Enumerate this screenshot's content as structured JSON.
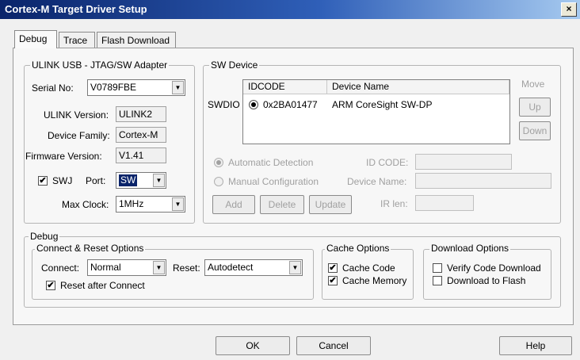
{
  "window": {
    "title": "Cortex-M Target Driver Setup",
    "close_glyph": "×"
  },
  "tabs": [
    "Debug",
    "Trace",
    "Flash Download"
  ],
  "ulink": {
    "title": "ULINK USB - JTAG/SW Adapter",
    "serial_label": "Serial No:",
    "serial_value": "V0789FBE",
    "version_label": "ULINK Version:",
    "version_value": "ULINK2",
    "family_label": "Device Family:",
    "family_value": "Cortex-M",
    "firmware_label": "Firmware Version:",
    "firmware_value": "V1.41",
    "swj_label": "SWJ",
    "swj_checked": true,
    "port_label": "Port:",
    "port_value": "SW",
    "maxclock_label": "Max Clock:",
    "maxclock_value": "1MHz"
  },
  "sw_device": {
    "title": "SW Device",
    "swdio_label": "SWDIO",
    "col_idcode": "IDCODE",
    "col_name": "Device Name",
    "row_idcode": "0x2BA01477",
    "row_name": "ARM CoreSight SW-DP",
    "move_label": "Move",
    "up_label": "Up",
    "down_label": "Down",
    "auto_label": "Automatic Detection",
    "manual_label": "Manual Configuration",
    "idcode_label": "ID CODE:",
    "devname_label": "Device Name:",
    "add_label": "Add",
    "delete_label": "Delete",
    "update_label": "Update",
    "irlen_label": "IR len:"
  },
  "debug": {
    "title": "Debug",
    "connect_group": "Connect & Reset Options",
    "connect_label": "Connect:",
    "connect_value": "Normal",
    "reset_label": "Reset:",
    "reset_value": "Autodetect",
    "reset_after_label": "Reset after Connect",
    "reset_after_checked": true,
    "cache_group": "Cache Options",
    "cache_code_label": "Cache Code",
    "cache_code_checked": true,
    "cache_mem_label": "Cache Memory",
    "cache_mem_checked": true,
    "download_group": "Download Options",
    "verify_label": "Verify Code Download",
    "verify_checked": false,
    "flash_label": "Download to Flash",
    "flash_checked": false
  },
  "footer": {
    "ok": "OK",
    "cancel": "Cancel",
    "help": "Help"
  },
  "glyphs": {
    "check": "✔",
    "arrow": "▼"
  }
}
